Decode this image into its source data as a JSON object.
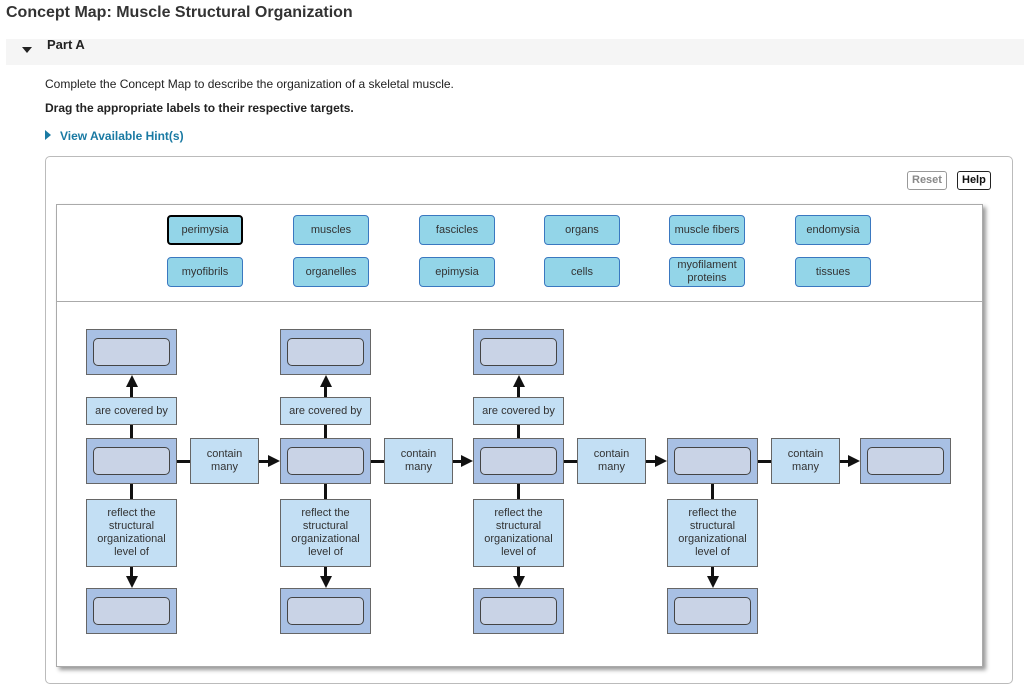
{
  "page": {
    "title": "Concept Map: Muscle Structural Organization",
    "part_label": "Part A",
    "instruction": "Complete the Concept Map to describe the organization of a skeletal muscle.",
    "instruction_bold": "Drag the appropriate labels to their respective targets.",
    "hint_link": "View Available Hint(s)"
  },
  "toolbar": {
    "reset_label": "Reset",
    "help_label": "Help"
  },
  "labels": [
    {
      "text": "perimysia",
      "selected": true
    },
    {
      "text": "muscles"
    },
    {
      "text": "fascicles"
    },
    {
      "text": "organs"
    },
    {
      "text": "muscle fibers"
    },
    {
      "text": "endomysia"
    },
    {
      "text": "myofibrils"
    },
    {
      "text": "organelles"
    },
    {
      "text": "epimysia"
    },
    {
      "text": "cells"
    },
    {
      "text": "myofilament proteins"
    },
    {
      "text": "tissues"
    }
  ],
  "concept_map": {
    "covered_by_text": "are covered by",
    "contain_text": "contain many",
    "reflect_text": "reflect the structural organizational level of"
  },
  "colors": {
    "label_fill": "#93d5e8",
    "label_border": "#3a78c0",
    "target_fill": "#a8c0e4",
    "slot_fill": "#c9d3e6",
    "link_fill": "#c3dff4",
    "hint_link": "#1a7aa3"
  }
}
